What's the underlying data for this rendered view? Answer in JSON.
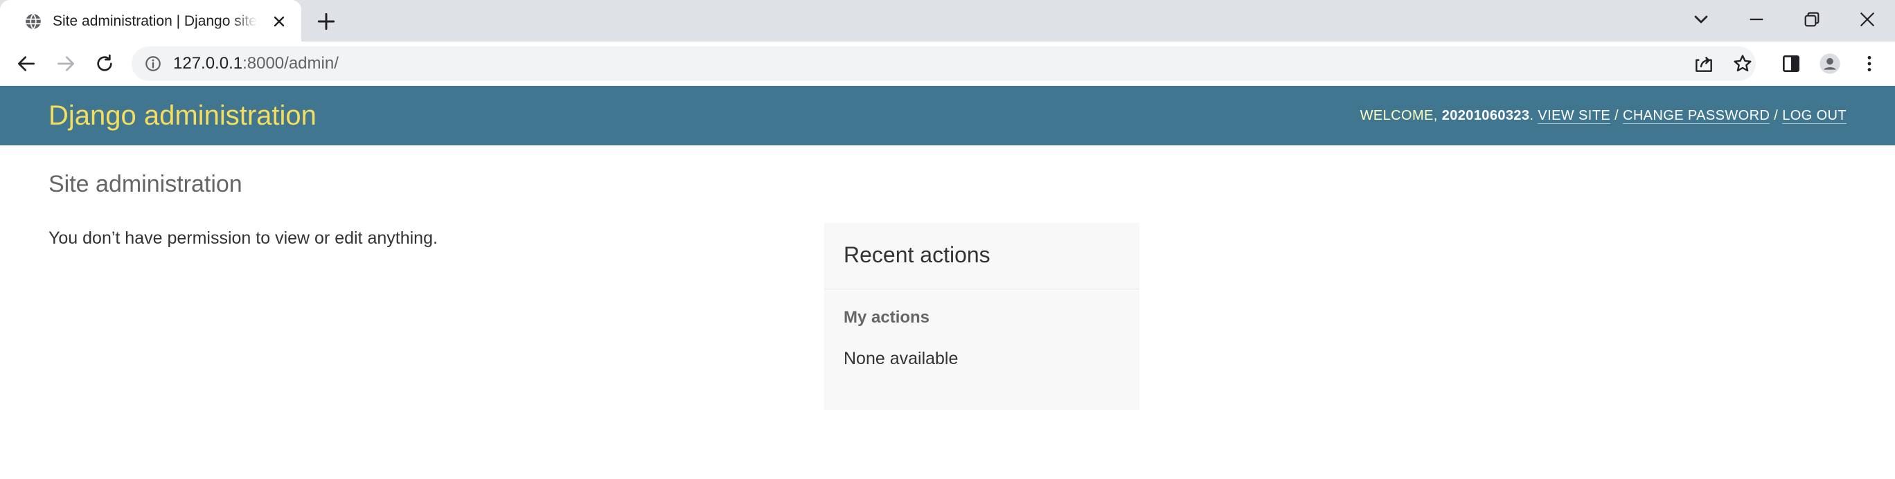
{
  "browser": {
    "tab": {
      "title": "Site administration | Django site admin"
    },
    "address_bar": {
      "host": "127.0.0.1",
      "path": ":8000/admin/"
    }
  },
  "header": {
    "branding": "Django administration",
    "welcome_prefix": "WELCOME, ",
    "username": "20201060323",
    "welcome_suffix": ". ",
    "view_site": "VIEW SITE",
    "separator": " / ",
    "change_password": "CHANGE PASSWORD",
    "log_out": "LOG OUT"
  },
  "content": {
    "title": "Site administration",
    "permission_message": "You don’t have permission to view or edit anything."
  },
  "recent_actions": {
    "heading": "Recent actions",
    "my_actions_heading": "My actions",
    "empty_text": "None available"
  },
  "colors": {
    "header_bg": "#417690",
    "branding": "#f5dd5d",
    "user_tools": "#ffffc0",
    "tab_strip": "#dee1e6",
    "omnibox": "#f1f3f4"
  }
}
